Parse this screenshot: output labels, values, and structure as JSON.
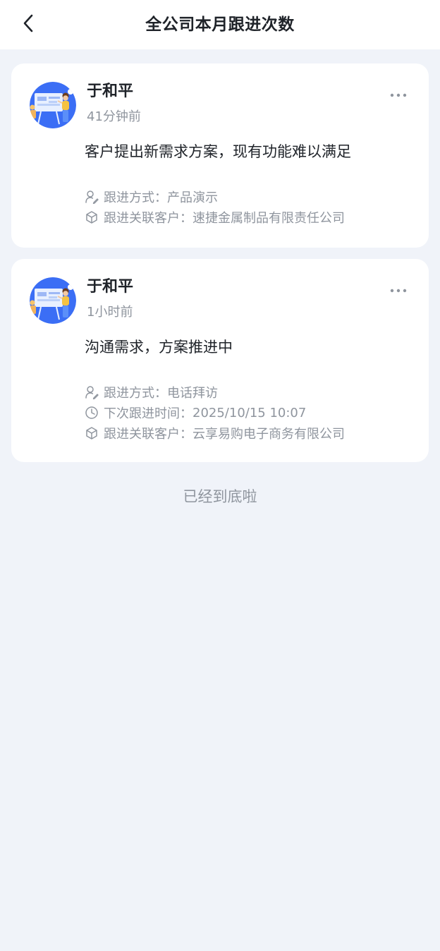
{
  "header": {
    "title": "全公司本月跟进次数",
    "back_icon": "chevron-left-icon"
  },
  "records": [
    {
      "author": "于和平",
      "time": "41分钟前",
      "content": "客户提出新需求方案，现有功能难以满足",
      "method_label": "跟进方式：",
      "method_value": "产品演示",
      "customer_label": "跟进关联客户：",
      "customer_value": "速捷金属制品有限责任公司"
    },
    {
      "author": "于和平",
      "time": "1小时前",
      "content": "沟通需求，方案推进中",
      "method_label": "跟进方式：",
      "method_value": "电话拜访",
      "next_label": "下次跟进时间：",
      "next_value": "2025/10/15 10:07",
      "customer_label": "跟进关联客户：",
      "customer_value": "云享易购电子商务有限公司"
    }
  ],
  "footer": {
    "end_text": "已经到底啦"
  },
  "colors": {
    "background": "#f0f3f9",
    "card": "#ffffff",
    "text_primary": "#1f2329",
    "text_secondary": "#8f959e",
    "avatar_blue": "#3b6ef5"
  }
}
